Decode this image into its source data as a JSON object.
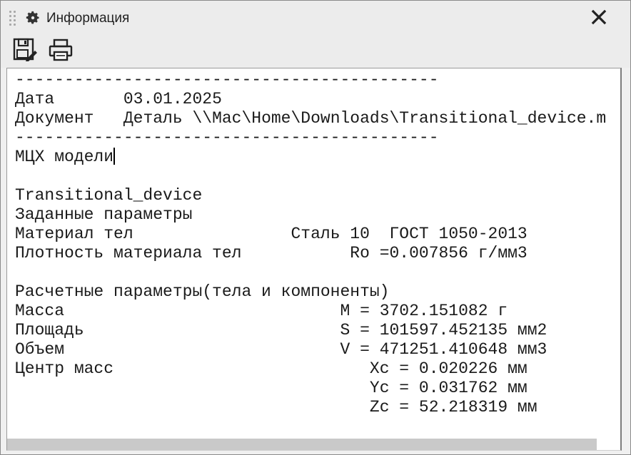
{
  "window": {
    "title": "Информация",
    "icons": {
      "drag": "drag-handle-icon",
      "settings": "gear-icon",
      "close": "close-icon"
    }
  },
  "toolbar": {
    "buttons": [
      {
        "name": "save-button",
        "icon": "save-edit-icon"
      },
      {
        "name": "print-button",
        "icon": "printer-icon"
      }
    ]
  },
  "report": {
    "separator_1": "-------------------------------------------",
    "date_label": "Дата",
    "date_value": "03.01.2025",
    "document_label": "Документ",
    "document_value": "Деталь \\\\Mac\\Home\\Downloads\\Transitional_device.m",
    "separator_2": "-------------------------------------------",
    "section_title": "МЦХ модели",
    "model_name": "Transitional_device",
    "given_params_title": "Заданные параметры",
    "material_label": "Материал тел",
    "material_value": "Сталь 10  ГОСТ 1050-2013",
    "density_label": "Плотность материала тел",
    "density_value": "Ro =0.007856 г/мм3",
    "calc_params_title": "Расчетные параметры(тела и компоненты)",
    "mass_label": "Масса",
    "mass_value": "M = 3702.151082 г",
    "area_label": "Площадь",
    "area_value": "S = 101597.452135 мм2",
    "volume_label": "Объем",
    "volume_value": "V = 471251.410648 мм3",
    "center_label": "Центр масс",
    "xc_value": "Xc = 0.020226 мм",
    "yc_value": "Yc = 0.031762 мм",
    "zc_value": "Zc = 52.218319 мм"
  },
  "colors": {
    "chrome_bg": "#ececec",
    "content_bg": "#ffffff",
    "text": "#1a1a1a",
    "scrollbar_thumb": "#c9c9c9"
  }
}
